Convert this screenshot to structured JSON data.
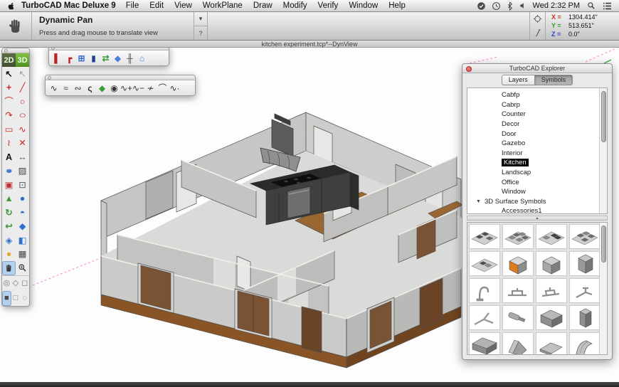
{
  "menu_bar": {
    "app_name": "TurboCAD Mac Deluxe 9",
    "menus": [
      "File",
      "Edit",
      "View",
      "WorkPlane",
      "Draw",
      "Modify",
      "Verify",
      "Window",
      "Help"
    ],
    "status_icons": [
      "sync-icon",
      "clock-icon",
      "bluetooth-icon",
      "volume-icon"
    ],
    "clock": "Wed 2:32 PM"
  },
  "tool_info": {
    "title": "Dynamic Pan",
    "description": "Press and drag mouse to translate view",
    "dropdown_glyph": "▾",
    "help_glyph": "?"
  },
  "coords": {
    "rows": [
      {
        "label": "X =",
        "value": "1304.414\"",
        "color": "#cc2a1f"
      },
      {
        "label": "Y =",
        "value": "513.651\"",
        "color": "#2f9e2f"
      },
      {
        "label": "Z =",
        "value": "0.0\"",
        "color": "#2244cc"
      }
    ]
  },
  "document": {
    "title": "kitchen experiment.tcp*--DynView"
  },
  "palette": {
    "mode_2d": "2D",
    "mode_3d": "3D",
    "tools": [
      {
        "name": "select-tool",
        "glyph": "↖",
        "color": "#111",
        "bold": true
      },
      {
        "name": "select-open-tool",
        "glyph": "↖",
        "color": "#9a9a9a"
      },
      {
        "name": "point-tool",
        "glyph": "+",
        "color": "#c22",
        "bold": true
      },
      {
        "name": "line-tool",
        "glyph": "╱",
        "color": "#c22"
      },
      {
        "name": "arc-tool",
        "glyph": "⌒",
        "color": "#c22"
      },
      {
        "name": "circle-tool",
        "glyph": "○",
        "color": "#c22"
      },
      {
        "name": "curve-tool",
        "glyph": "↷",
        "color": "#c22"
      },
      {
        "name": "ellipse-tool",
        "glyph": "○",
        "color": "#c22",
        "stretch": true
      },
      {
        "name": "rectangle-tool",
        "glyph": "▭",
        "color": "#c22"
      },
      {
        "name": "spline-tool",
        "glyph": "∿",
        "color": "#c22"
      },
      {
        "name": "modify-curve-tool",
        "glyph": "≀",
        "color": "#c22"
      },
      {
        "name": "cross-tool",
        "glyph": "✕",
        "color": "#c22"
      },
      {
        "name": "text-tool",
        "glyph": "A",
        "color": "#111",
        "bold": true
      },
      {
        "name": "dimension-tool",
        "glyph": "↔",
        "color": "#555"
      },
      {
        "name": "cloud-tool",
        "glyph": "●",
        "color": "#4a7fd6",
        "stretch": true
      },
      {
        "name": "hatch-tool",
        "glyph": "▨",
        "color": "#444"
      },
      {
        "name": "trim-tool",
        "glyph": "▣",
        "color": "#b33"
      },
      {
        "name": "node-edit-tool",
        "glyph": "⊡",
        "color": "#555"
      },
      {
        "name": "cone-3d-tool",
        "glyph": "▲",
        "color": "#3a9e3a"
      },
      {
        "name": "sphere-3d-tool",
        "glyph": "●",
        "color": "#2e6fd0"
      },
      {
        "name": "rotate-3d-tool",
        "glyph": "↻",
        "color": "#3a9e3a",
        "bold": true
      },
      {
        "name": "hemisphere-3d-tool",
        "glyph": "◓",
        "color": "#2e6fd0"
      },
      {
        "name": "sweep-3d-tool",
        "glyph": "↩",
        "color": "#3a9e3a",
        "bold": true
      },
      {
        "name": "cube-3d-tool",
        "glyph": "◆",
        "color": "#2e6fd0"
      },
      {
        "name": "prism-3d-tool",
        "glyph": "◈",
        "color": "#2e6fd0"
      },
      {
        "name": "split-3d-tool",
        "glyph": "◧",
        "color": "#2e6fd0"
      },
      {
        "name": "material-tool",
        "glyph": "●",
        "color": "#dfae2f"
      },
      {
        "name": "render-options-tool",
        "glyph": "▦",
        "color": "#444"
      },
      {
        "name": "pan-tool",
        "icon": "hand",
        "selected": true
      },
      {
        "name": "zoom-tool",
        "icon": "magnifier"
      }
    ],
    "view_tools": [
      {
        "name": "view-iso-1",
        "glyph": "◎",
        "color": "#777"
      },
      {
        "name": "view-iso-2",
        "glyph": "◇",
        "color": "#777"
      },
      {
        "name": "view-iso-3",
        "glyph": "◻",
        "color": "#777"
      },
      {
        "name": "view-shaded",
        "glyph": "■",
        "color": "#4a4a4a",
        "selected": true
      },
      {
        "name": "view-wireframe",
        "glyph": "□",
        "color": "#777"
      },
      {
        "name": "view-hidden-line",
        "glyph": "◌",
        "color": "#777"
      }
    ]
  },
  "arch_toolbar": {
    "tools": [
      {
        "name": "wall-tool",
        "glyph": "▌",
        "color": "#b22"
      },
      {
        "name": "corner-wall-tool",
        "glyph": "┏",
        "color": "#b22",
        "bold": true
      },
      {
        "name": "window-tool",
        "glyph": "⊞",
        "color": "#3a6fd0",
        "bold": true
      },
      {
        "name": "door-tool",
        "glyph": "▮",
        "color": "#1f3f8f"
      },
      {
        "name": "convert-tool",
        "glyph": "⇄",
        "color": "#3a9e3a",
        "bold": true
      },
      {
        "name": "slab-tool",
        "glyph": "◆",
        "color": "#4a7fd6"
      },
      {
        "name": "railing-tool",
        "glyph": "╫",
        "color": "#555",
        "bold": true
      },
      {
        "name": "roof-tool",
        "glyph": "⌂",
        "color": "#4a7fd6",
        "bold": true
      }
    ]
  },
  "spline_toolbar": {
    "tools": [
      {
        "name": "spline-by-points-tool",
        "glyph": "∿",
        "color": "#333"
      },
      {
        "name": "interpolated-spline-tool",
        "glyph": "≈",
        "color": "#333"
      },
      {
        "name": "multi-spline-tool",
        "glyph": "∾",
        "color": "#333"
      },
      {
        "name": "sketch-curve-tool",
        "glyph": "ς",
        "color": "#333",
        "bold": true
      },
      {
        "name": "surface-patch-tool",
        "glyph": "◆",
        "color": "#3a9e3a"
      },
      {
        "name": "spiral-curve-tool",
        "glyph": "◉",
        "color": "#333"
      },
      {
        "name": "add-node-tool",
        "glyph": "∿+",
        "color": "#333"
      },
      {
        "name": "remove-node-tool",
        "glyph": "∿−",
        "color": "#333"
      },
      {
        "name": "split-curve-tool",
        "glyph": "≁",
        "color": "#333"
      },
      {
        "name": "arc-curve-tool",
        "glyph": "⌒",
        "color": "#333"
      },
      {
        "name": "refine-curve-tool",
        "glyph": "∿·",
        "color": "#333"
      }
    ]
  },
  "explorer": {
    "title": "TurboCAD Explorer",
    "tabs": [
      {
        "label": "Layers",
        "selected": false
      },
      {
        "label": "Symbols",
        "selected": true
      }
    ],
    "folders": [
      "Cabfp",
      "Cabrp",
      "Counter",
      "Decor",
      "Door",
      "Gazebo",
      "Interior",
      "Kitchen",
      "Landscap",
      "Office",
      "Window"
    ],
    "selected_folder": "Kitchen",
    "group_label": "3D Surface Symbols",
    "group_glyph": "▼",
    "subgroup_label": "Accessories1",
    "divider_glyph": "▴",
    "symbols": [
      {
        "name": "countertop-1",
        "kind": "planA"
      },
      {
        "name": "countertop-2",
        "kind": "planB"
      },
      {
        "name": "countertop-3",
        "kind": "planC"
      },
      {
        "name": "countertop-4",
        "kind": "planD"
      },
      {
        "name": "countertop-5",
        "kind": "planE"
      },
      {
        "name": "cabinet-orange",
        "kind": "cabOrange"
      },
      {
        "name": "cabinet-gray",
        "kind": "cabGray"
      },
      {
        "name": "cabinet-tall",
        "kind": "boxTall2"
      },
      {
        "name": "faucet-gooseneck",
        "kind": "faucetGoose"
      },
      {
        "name": "faucet-bar-1",
        "kind": "faucetBar"
      },
      {
        "name": "faucet-bar-2",
        "kind": "faucetBar2"
      },
      {
        "name": "faucet-angled",
        "kind": "faucetAngle"
      },
      {
        "name": "faucet-lever",
        "kind": "faucetLever"
      },
      {
        "name": "sprayer",
        "kind": "spray"
      },
      {
        "name": "refrigerator",
        "kind": "boxBig"
      },
      {
        "name": "cabinet-narrow",
        "kind": "boxTall"
      },
      {
        "name": "appliance-wide",
        "kind": "boxWide"
      },
      {
        "name": "hood-wedge",
        "kind": "hoodWedge"
      },
      {
        "name": "hood-flat",
        "kind": "hoodFlat"
      },
      {
        "name": "hood-curved",
        "kind": "hoodCurve"
      }
    ]
  },
  "colors": {
    "construction_line": "#ff8fd8",
    "construction_tick_green": "#3fae3f",
    "wall_face": "#cacac8",
    "wall_face_dark": "#b9b9b7",
    "wall_inner": "#c6c6c4",
    "base_brown": "#8a5526",
    "base_brown_dark": "#6f441f",
    "door_brown": "#7a5334",
    "kitchen_floor": "#996832",
    "counter_dark": "#3f3f3d",
    "accent_orange": "#e07a1f"
  }
}
